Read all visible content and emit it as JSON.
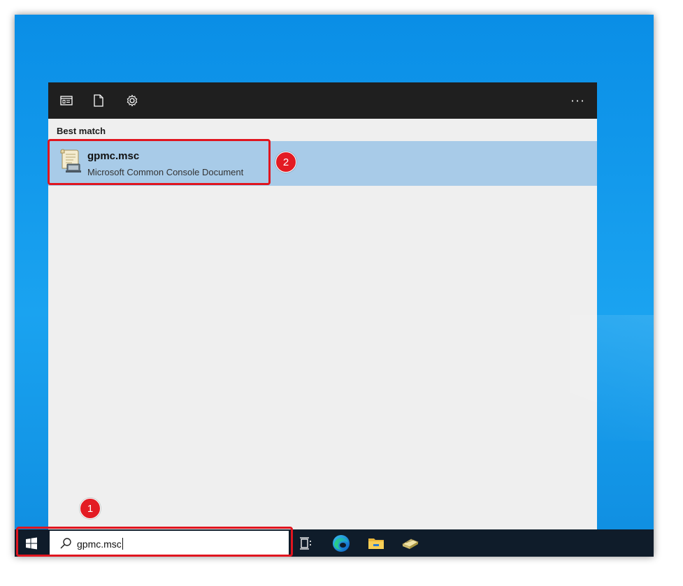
{
  "toolbar": {
    "icons": [
      "apps-icon",
      "documents-icon",
      "settings-icon"
    ],
    "more_label": "···"
  },
  "results": {
    "section_label": "Best match",
    "best_match": {
      "title": "gpmc.msc",
      "subtitle": "Microsoft Common Console Document",
      "icon": "msc-console-icon"
    }
  },
  "taskbar": {
    "search_value": "gpmc.msc",
    "apps": [
      "task-view-icon",
      "edge-icon",
      "file-explorer-icon",
      "server-manager-icon"
    ]
  },
  "annotations": {
    "step1": "1",
    "step2": "2",
    "color": "#e0151f"
  },
  "colors": {
    "selection": "#a8cbe8",
    "toolbar": "#1f1f1f",
    "taskbar": "#0f1c2a",
    "desktop": "#1aa3f0"
  }
}
